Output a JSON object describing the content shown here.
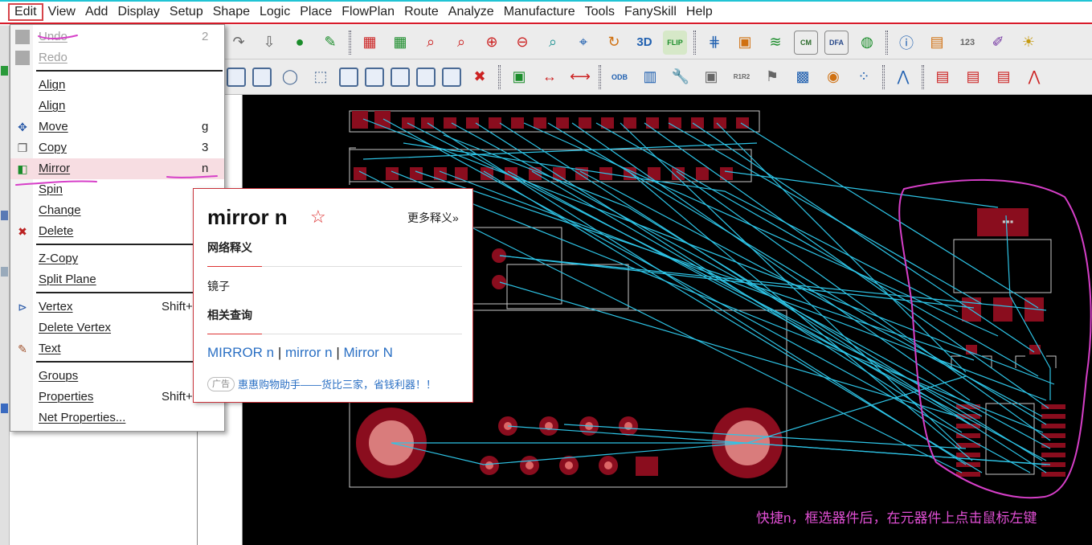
{
  "menubar": {
    "items": [
      "Edit",
      "View",
      "Add",
      "Display",
      "Setup",
      "Shape",
      "Logic",
      "Place",
      "FlowPlan",
      "Route",
      "Analyze",
      "Manufacture",
      "Tools",
      "FanySkill",
      "Help"
    ]
  },
  "toolbar1": {
    "items": [
      "redo-icon",
      "down-icon",
      "ball-icon",
      "pin-icon",
      "grid-icon",
      "grid2-icon",
      "zoom-fit-icon",
      "zoom-region-icon",
      "zoom-in-icon",
      "zoom-out-icon",
      "zoom-prev-icon",
      "zoom-world-icon",
      "refresh-icon",
      "3d-icon",
      "flip-icon",
      "grid-dots-icon",
      "palette-icon",
      "layers-icon",
      "cm-icon",
      "dfa-icon",
      "globe-icon",
      "info-icon",
      "measure-icon",
      "number-icon",
      "brush-icon",
      "sun-icon"
    ],
    "labels": {
      "threed": "3D",
      "flip": "FLIP",
      "cm": "CM",
      "dfa": "DFA",
      "num": "123"
    }
  },
  "toolbar2": {
    "items": [
      "rect-icon",
      "rect2-icon",
      "circle-icon",
      "select-icon",
      "shape-icon",
      "arc-icon",
      "square-icon",
      "ring-icon",
      "fill-icon",
      "eraser-icon",
      "chip-icon",
      "dimension-icon",
      "dimension2-icon",
      "odb-icon",
      "book-icon",
      "wrench-icon",
      "camera-icon",
      "refdes-icon",
      "flag-icon",
      "matrix-icon",
      "testpoint-icon",
      "array-icon",
      "wave-icon",
      "doc-icon",
      "doc2-icon",
      "doc3-icon",
      "wave2-icon"
    ],
    "labels": {
      "odb": "ODB",
      "refdes": "R1R2"
    }
  },
  "edit_menu": {
    "items": [
      {
        "label": "Undo",
        "shortcut": "2",
        "disabled": true
      },
      {
        "label": "Redo",
        "shortcut": "",
        "disabled": true
      },
      {
        "label": "Align",
        "shortcut": ""
      },
      {
        "label": "Align",
        "shortcut": ""
      },
      {
        "label": "Move",
        "shortcut": "g"
      },
      {
        "label": "Copy",
        "shortcut": "3"
      },
      {
        "label": "Mirror",
        "shortcut": "n",
        "highlighted": true
      },
      {
        "label": "Spin",
        "shortcut": ""
      },
      {
        "label": "Change",
        "shortcut": ""
      },
      {
        "label": "Delete",
        "shortcut": ""
      },
      {
        "label": "Z-Copy",
        "shortcut": ""
      },
      {
        "label": "Split Plane",
        "shortcut": ""
      },
      {
        "label": "Vertex",
        "shortcut": "Shift+"
      },
      {
        "label": "Delete Vertex",
        "shortcut": ""
      },
      {
        "label": "Text",
        "shortcut": ""
      },
      {
        "label": "Groups",
        "shortcut": ""
      },
      {
        "label": "Properties",
        "shortcut": "Shift+"
      },
      {
        "label": "Net Properties...",
        "shortcut": ""
      }
    ]
  },
  "dictionary_popup": {
    "word": "mirror n",
    "more_link": "更多释义»",
    "section_web": "网络释义",
    "meaning": "镜子",
    "section_related": "相关查询",
    "related": [
      "MIRROR n",
      "mirror n",
      "Mirror N"
    ],
    "separator": "|",
    "ad_badge": "广告",
    "ad_text": "惠惠购物助手——货比三家，省钱利器！！"
  },
  "annotation": {
    "text": "快捷n，框选器件后，在元器件上点击鼠标左键"
  },
  "colors": {
    "accent_red": "#d81b2a",
    "pad": "#8a0d1e",
    "trace": "#2ec4e6",
    "outline": "#c8c8c8",
    "annotation": "#e14fd4",
    "canvas": "#000000"
  }
}
